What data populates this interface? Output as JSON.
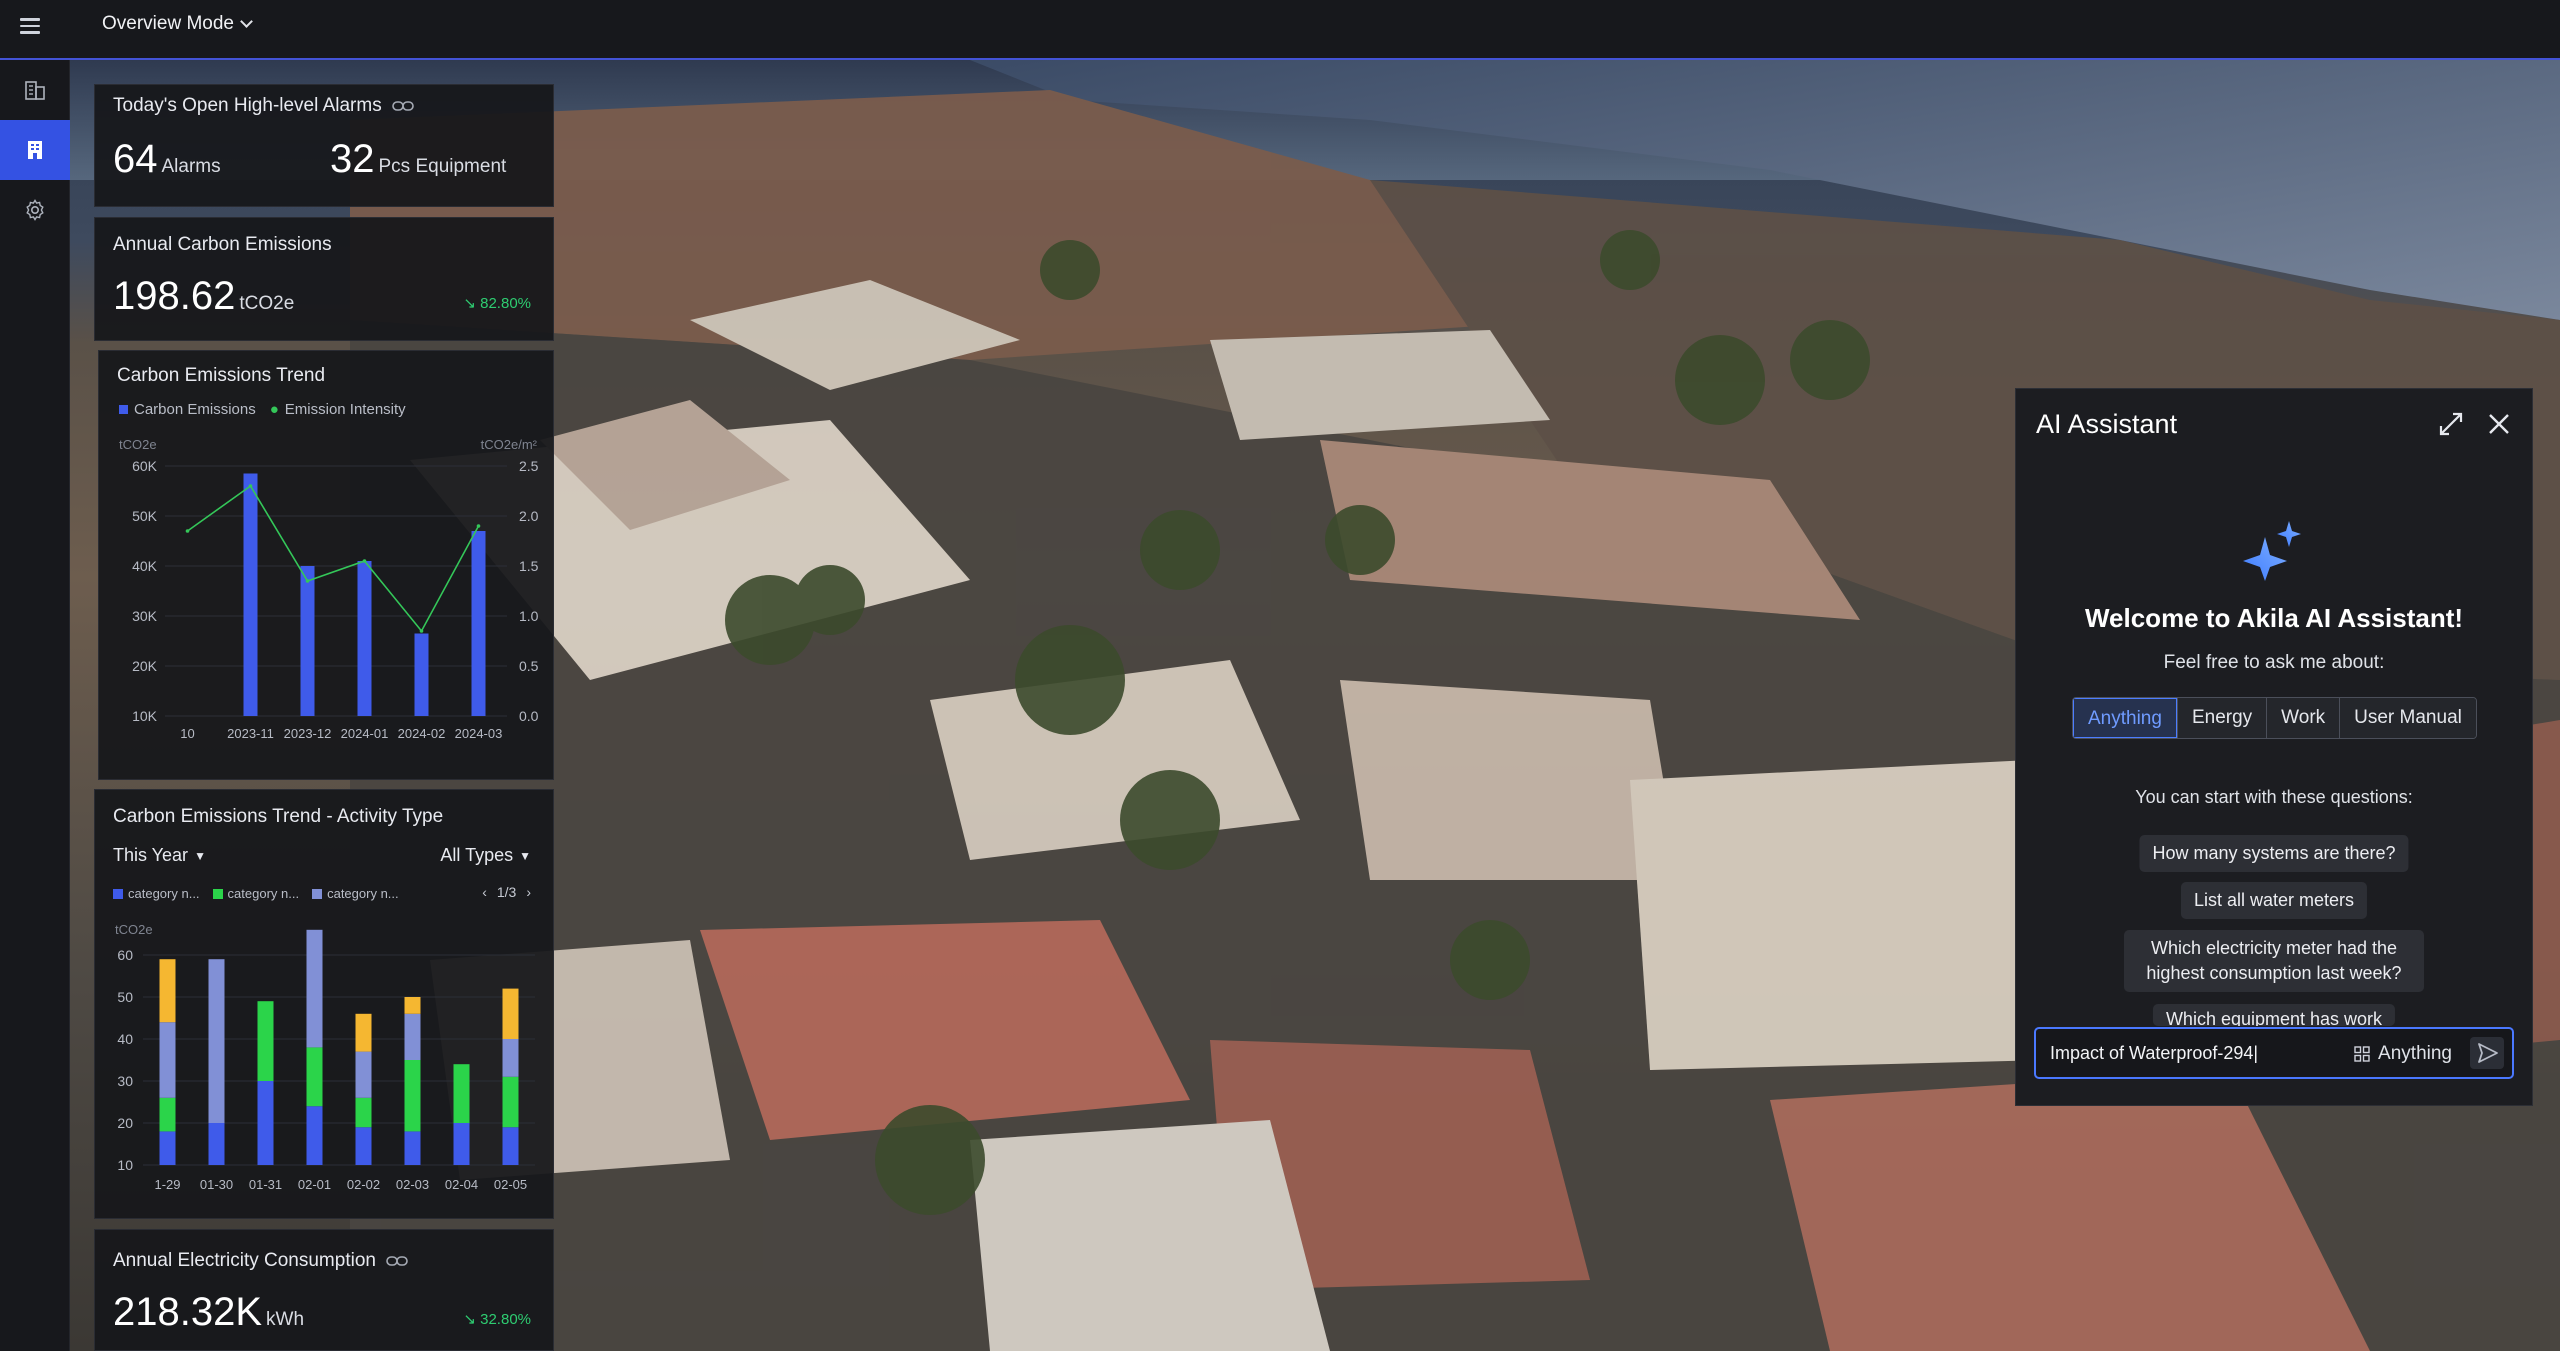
{
  "topbar": {
    "mode_label": "Overview Mode"
  },
  "rail": {
    "items": [
      "buildings-icon",
      "building-icon",
      "gear-icon"
    ],
    "active_index": 1
  },
  "alarms": {
    "title": "Today's Open High-level Alarms",
    "alarms_value": "64",
    "alarms_unit": "Alarms",
    "equipment_value": "32",
    "equipment_unit": "Pcs Equipment"
  },
  "carbon": {
    "title": "Annual Carbon Emissions",
    "value": "198.62",
    "unit": "tCO2e",
    "change": "82.80%"
  },
  "trend_chart": {
    "title": "Carbon Emissions Trend",
    "legend_bar": "Carbon Emissions",
    "legend_line": "Emission Intensity",
    "left_unit": "tCO2e",
    "right_unit": "tCO2e/m²",
    "y_left_ticks": [
      "60K",
      "50K",
      "40K",
      "30K",
      "20K",
      "10K"
    ],
    "y_right_ticks": [
      "2.5",
      "2.0",
      "1.5",
      "1.0",
      "0.5",
      "0.0"
    ],
    "first_x_label": "10"
  },
  "activity": {
    "title": "Carbon Emissions Trend - Activity Type",
    "period": "This Year",
    "types": "All Types",
    "legend": [
      "category n...",
      "category n...",
      "category n..."
    ],
    "pager": "1/3",
    "y_unit": "tCO2e",
    "y_ticks": [
      "60",
      "50",
      "40",
      "30",
      "20",
      "10"
    ]
  },
  "electricity": {
    "title": "Annual Electricity Consumption",
    "value": "218.32K",
    "unit": "kWh",
    "change": "32.80%"
  },
  "ai": {
    "title": "AI Assistant",
    "welcome": "Welcome to Akila AI Assistant!",
    "subtitle": "Feel free to ask me about:",
    "tabs": [
      "Anything",
      "Energy",
      "Work",
      "User Manual"
    ],
    "selected_tab": "Anything",
    "start_text": "You can start with these questions:",
    "questions": [
      "How many systems are there?",
      "List all water meters",
      "Which electricity meter had the highest consumption last week?",
      "Which equipment has work"
    ],
    "input_value": "Impact of Waterproof-294|",
    "scope": "Anything"
  },
  "chart_data": [
    {
      "type": "bar",
      "title": "Carbon Emissions Trend",
      "categories": [
        "2023-11",
        "2023-12",
        "2024-01",
        "2024-02",
        "2024-03"
      ],
      "series": [
        {
          "name": "Carbon Emissions",
          "type": "bar",
          "axis": "left",
          "values": [
            58500,
            40000,
            41000,
            26500,
            47000
          ]
        },
        {
          "name": "Emission Intensity",
          "type": "line",
          "axis": "right",
          "x": [
            "10",
            "2023-11",
            "2023-12",
            "2024-01",
            "2024-02",
            "2024-03"
          ],
          "values": [
            1.85,
            2.3,
            1.35,
            1.55,
            0.85,
            1.9
          ]
        }
      ],
      "ylim_left": [
        10000,
        60000
      ],
      "ylim_right": [
        0,
        2.5
      ],
      "colors": {
        "bar": "#3f5bea",
        "line": "#34c759"
      }
    },
    {
      "type": "bar",
      "stacked": true,
      "title": "Carbon Emissions Trend - Activity Type",
      "categories": [
        "1-29",
        "01-30",
        "01-31",
        "02-01",
        "02-02",
        "02-03",
        "02-04",
        "02-05"
      ],
      "series": [
        {
          "name": "category n...",
          "color": "#3f5bea",
          "values": [
            8,
            10,
            20,
            14,
            9,
            8,
            10,
            9
          ]
        },
        {
          "name": "category n...",
          "color": "#2bd44a",
          "values": [
            8,
            0,
            19,
            14,
            7,
            17,
            14,
            12
          ]
        },
        {
          "name": "category n...",
          "color": "#8190d6",
          "values": [
            18,
            39,
            0,
            28,
            11,
            11,
            0,
            9
          ]
        },
        {
          "name": "",
          "color": "#f5b731",
          "values": [
            15,
            0,
            0,
            0,
            9,
            4,
            0,
            12
          ]
        }
      ],
      "ylim": [
        10,
        60
      ]
    }
  ]
}
